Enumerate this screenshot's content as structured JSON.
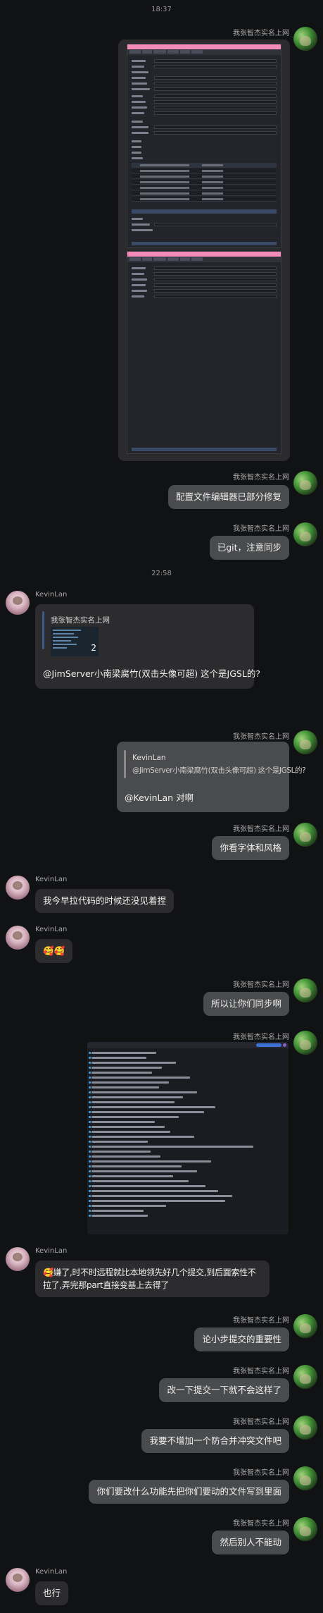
{
  "status": {
    "time_top": "18:37"
  },
  "messages": [
    {
      "sender": "我张智杰实名上网",
      "type": "image",
      "alt": "screenshot"
    },
    {
      "sender": "我张智杰实名上网",
      "text": "配置文件编辑器已部分修复"
    },
    {
      "sender": "我张智杰实名上网",
      "text": "已git，注意同步"
    },
    {
      "divider": "22:58"
    },
    {
      "sender": "KevinLan",
      "quote_author": "我张智杰实名上网",
      "quote_badge": "2",
      "text": "@JimServer小南梁腐竹(双击头像可超) 这个是JGSL的?"
    },
    {
      "sender": "我张智杰实名上网",
      "quote_author": "KevinLan",
      "quote_text": "@JimServer小南梁腐竹(双击头像可超) 这个是JGSL的?",
      "text": "@KevinLan 对啊"
    },
    {
      "sender": "我张智杰实名上网",
      "text": "你看字体和风格"
    },
    {
      "sender": "KevinLan",
      "text": "我今早拉代码的时候还没见着捏"
    },
    {
      "sender": "KevinLan",
      "text": "🥰🥰"
    },
    {
      "sender": "我张智杰实名上网",
      "text": "所以让你们同步啊"
    },
    {
      "sender": "我张智杰实名上网",
      "type": "image",
      "alt": "log screenshot"
    },
    {
      "sender": "KevinLan",
      "text_line1": "🥰嫌了,时不时远程就比本地领先好几个提交,到后面索性不",
      "text_line2": "拉了,弄完那part直接变基上去得了"
    },
    {
      "sender": "我张智杰实名上网",
      "text": "论小步提交的重要性"
    },
    {
      "sender": "我张智杰实名上网",
      "text": "改一下提交一下就不会这样了"
    },
    {
      "sender": "我张智杰实名上网",
      "text": "我要不增加一个防合并冲突文件吧"
    },
    {
      "sender": "我张智杰实名上网",
      "text": "你们要改什么功能先把你们要动的文件写到里面"
    },
    {
      "sender": "我张智杰实名上网",
      "text": "然后别人不能动"
    },
    {
      "sender": "KevinLan",
      "text": "也行"
    }
  ],
  "colors": {
    "bg": "#111214",
    "bubble_self": "#4a4b4d",
    "bubble_other": "#2c2c2e",
    "editor_title": "#f48bb8"
  },
  "icons": {
    "avatar_self": "green-avatar-icon",
    "avatar_other": "pink-avatar-icon"
  }
}
